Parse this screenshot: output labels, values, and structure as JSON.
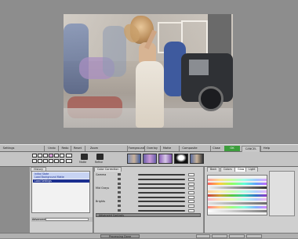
{
  "toolbar": {
    "items": [
      "Settings",
      "Undo",
      "Redo",
      "Reset",
      "Zoom",
      "Foreground",
      "Overlay",
      "Matte",
      "Composite",
      "Close",
      "OK",
      "CANCEL",
      "Help"
    ]
  },
  "tools": {
    "matte_label": "Matte",
    "refine_label": "Refine",
    "thumbnails": [
      "composite",
      "foreground",
      "overlay",
      "matte",
      "composite"
    ]
  },
  "left_panel": {
    "tab": "History",
    "history_items": [
      {
        "label": "Initial State",
        "style": "norm"
      },
      {
        "label": "Load Background Matte",
        "style": "norm"
      },
      {
        "label": "Load Settings",
        "style": "sel"
      }
    ],
    "advanced_label": "Advanced"
  },
  "center_panel": {
    "tab": "Color Correction",
    "sliders": [
      {
        "label": "Gamma",
        "values": [
          "",
          "",
          ""
        ]
      },
      {
        "label": "Mid Grays",
        "values": [
          "",
          "",
          ""
        ]
      },
      {
        "label": "Brights",
        "values": [
          "",
          "",
          ""
        ]
      }
    ],
    "advanced_controls_label": "Advanced Controls"
  },
  "right_panel": {
    "tabs": [
      "Back",
      "Colors",
      "Glow",
      "Light"
    ]
  },
  "bottom_bar": {
    "status": "Processing Done",
    "segments": [
      "",
      "",
      "",
      ""
    ]
  },
  "colors": {
    "accent_green": "#3c9d3c",
    "selection_blue": "#1b2f8f",
    "panel_gray": "#cdcdcd"
  }
}
